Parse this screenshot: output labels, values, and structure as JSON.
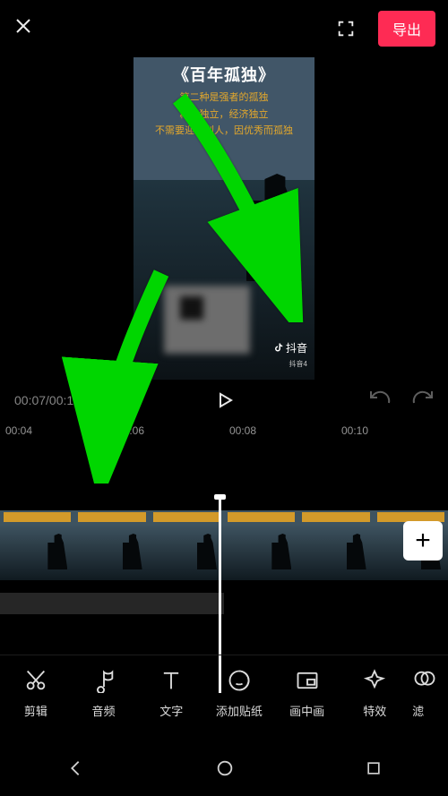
{
  "header": {
    "export_label": "导出"
  },
  "preview": {
    "title": "《百年孤独》",
    "line1": "第二种是强者的孤独",
    "line2": "精神独立，经济独立",
    "line3": "不需要迎合别人，因优秀而孤独",
    "watermark_label": "抖音",
    "watermark_id": "抖音4"
  },
  "transport": {
    "time": "00:07/00:18"
  },
  "ruler": {
    "marks": [
      "00:04",
      "00:06",
      "00:08",
      "00:10"
    ]
  },
  "tools": {
    "cut": "剪辑",
    "audio": "音频",
    "text": "文字",
    "sticker": "添加贴纸",
    "pip": "画中画",
    "fx": "特效",
    "filter": "滤"
  }
}
